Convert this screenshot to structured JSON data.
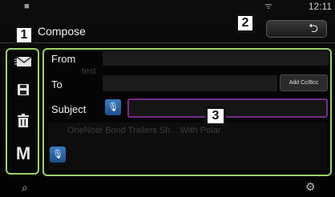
{
  "status": {
    "time": "12:11"
  },
  "header": {
    "title": "Compose",
    "back_symbol": "⮌"
  },
  "callouts": {
    "one": "1",
    "two": "2",
    "three": "3"
  },
  "toolbar": {
    "items": [
      {
        "icon": "mail-icon"
      },
      {
        "icon": "save-icon"
      },
      {
        "icon": "trash-icon"
      },
      {
        "icon": "gmail-icon",
        "glyph": "M"
      }
    ]
  },
  "compose": {
    "from_label": "From",
    "to_label": "To",
    "subject_label": "Subject",
    "add_cc_label": "Add Cc/Bcc",
    "ghost_from": "test",
    "ghost_body": "OneNote Bond Trailers Sh... With Polar"
  },
  "colors": {
    "highlight": "#9bd36a",
    "subject_focus": "#7a2a8a",
    "mic": "#2b66a8"
  }
}
